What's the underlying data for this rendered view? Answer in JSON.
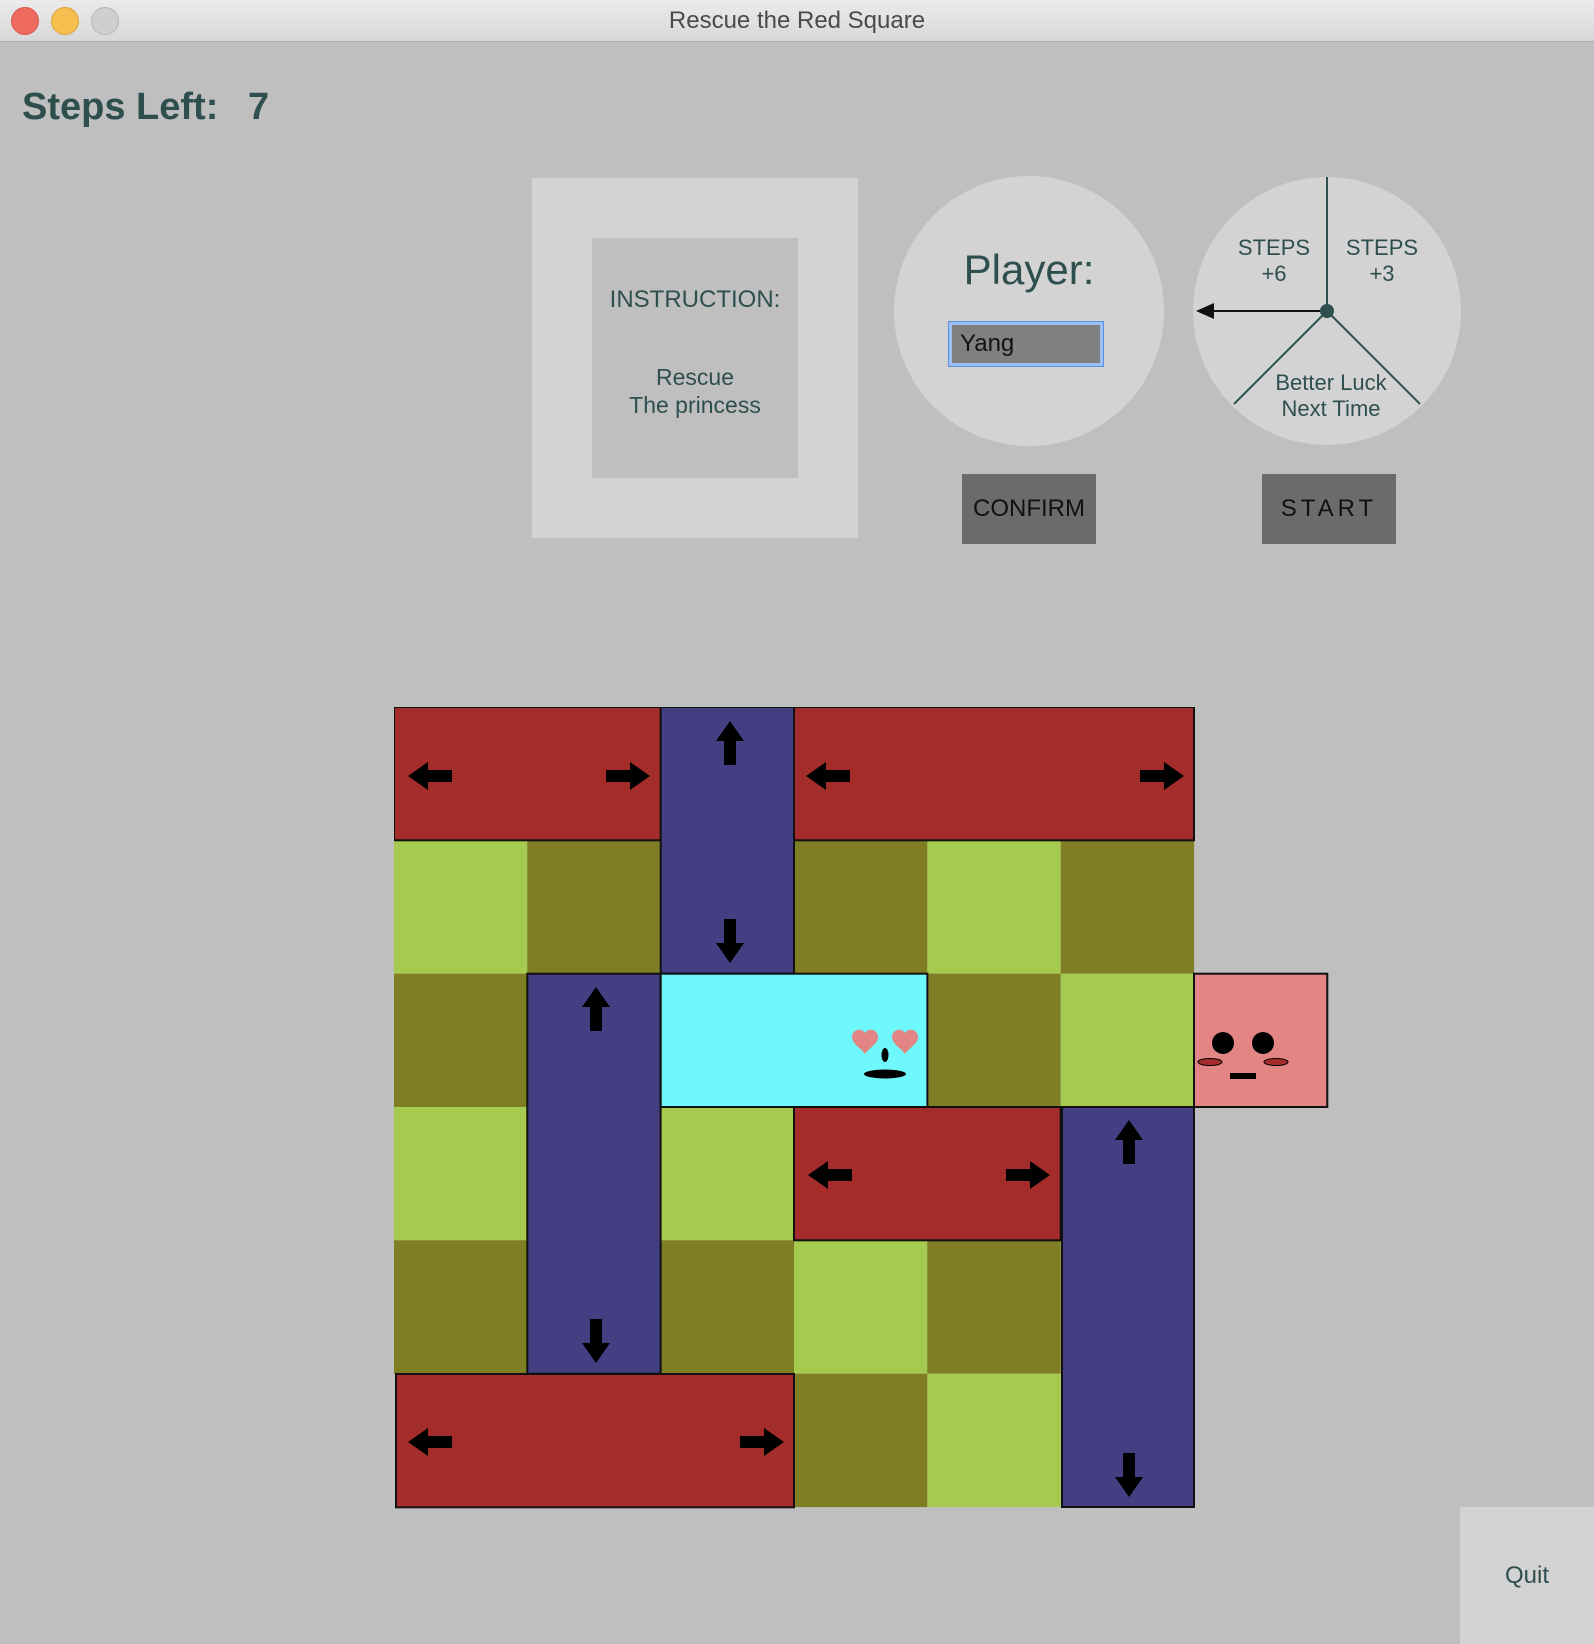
{
  "window": {
    "title": "Rescue the Red Square"
  },
  "status": {
    "steps_label": "Steps Left:",
    "steps_left": "7"
  },
  "instruction": {
    "heading": "INSTRUCTION:",
    "line1": "Rescue",
    "line2": "The princess"
  },
  "player": {
    "label": "Player:",
    "name_value": "Yang"
  },
  "buttons": {
    "confirm": "CONFIRM",
    "start": "START",
    "quit": "Quit"
  },
  "wheel": {
    "segments": [
      {
        "line1": "STEPS",
        "line2": "+6"
      },
      {
        "line1": "STEPS",
        "line2": "+3"
      },
      {
        "line1": "Better Luck",
        "line2": "Next Time"
      }
    ]
  },
  "colors": {
    "background": "#bfbfbf",
    "panel": "#d3d3d3",
    "text": "#2f4f4f",
    "horizontal_block": "#a42d2b",
    "vertical_block": "#433f82",
    "tile_light": "#a6c950",
    "tile_dark": "#7f7e25",
    "hero": "#6ff8fc",
    "princess": "#e48585",
    "button": "#6b6b6b"
  },
  "icons": {
    "horizontal_block": [
      "arrow-left-icon",
      "arrow-right-icon"
    ],
    "vertical_block": [
      "arrow-up-icon",
      "arrow-down-icon"
    ],
    "hero": "heart-eyes-face-icon",
    "princess": "blush-face-icon"
  }
}
